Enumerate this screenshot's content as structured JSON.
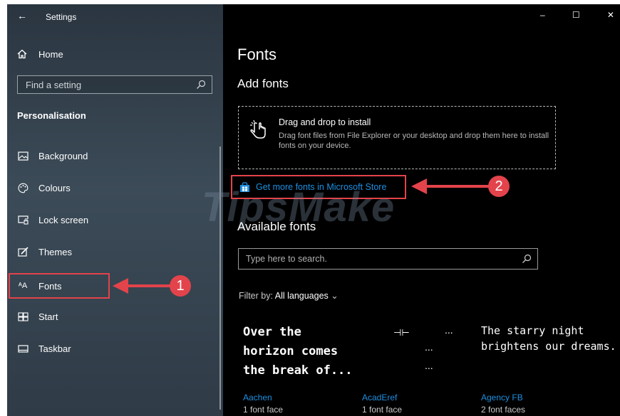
{
  "window": {
    "title": "Settings",
    "controls": {
      "minimize": "–",
      "maximize": "☐",
      "close": "✕"
    }
  },
  "sidebar": {
    "back": "←",
    "home_label": "Home",
    "search_placeholder": "Find a setting",
    "section_title": "Personalisation",
    "items": [
      {
        "label": "Background",
        "icon": "picture-icon"
      },
      {
        "label": "Colours",
        "icon": "palette-icon"
      },
      {
        "label": "Lock screen",
        "icon": "lock-screen-icon"
      },
      {
        "label": "Themes",
        "icon": "brush-icon"
      },
      {
        "label": "Fonts",
        "icon": "fonts-icon",
        "selected": true
      },
      {
        "label": "Start",
        "icon": "start-icon"
      },
      {
        "label": "Taskbar",
        "icon": "taskbar-icon"
      }
    ]
  },
  "main": {
    "page_title": "Fonts",
    "add_fonts_heading": "Add fonts",
    "drop": {
      "title": "Drag and drop to install",
      "description": "Drag font files from File Explorer or your desktop and drop them here to install fonts on your device."
    },
    "store_link": "Get more fonts in Microsoft Store",
    "available_heading": "Available fonts",
    "search_placeholder": "Type here to search.",
    "filter_label": "Filter by:",
    "filter_value": "All languages",
    "fonts": [
      {
        "name": "Aachen",
        "faces": "1 font face",
        "preview": [
          "Over the",
          "horizon comes",
          "the break of..."
        ]
      },
      {
        "name": "AcadEref",
        "faces": "1 font face",
        "preview": [
          "⊣⊢",
          "...",
          "...",
          "..."
        ]
      },
      {
        "name": "Agency FB",
        "faces": "2 font faces",
        "preview": [
          "The starry night",
          "brightens our dreams."
        ]
      }
    ]
  },
  "callouts": {
    "one": "1",
    "two": "2"
  },
  "watermark": "TipsMake",
  "colors": {
    "accent": "#1e8fe0",
    "callout": "#e3434b"
  }
}
